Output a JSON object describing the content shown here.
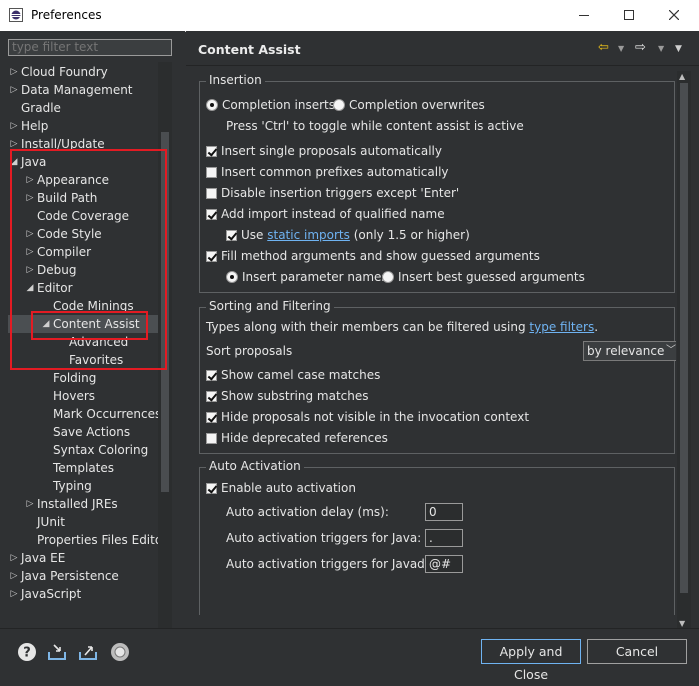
{
  "window": {
    "title": "Preferences"
  },
  "sidebar": {
    "filter_placeholder": "type filter text",
    "items": [
      {
        "label": "Cloud Foundry",
        "level": 0,
        "arrow": "right"
      },
      {
        "label": "Data Management",
        "level": 0,
        "arrow": "right"
      },
      {
        "label": "Gradle",
        "level": 0,
        "arrow": "none"
      },
      {
        "label": "Help",
        "level": 0,
        "arrow": "right"
      },
      {
        "label": "Install/Update",
        "level": 0,
        "arrow": "right"
      },
      {
        "label": "Java",
        "level": 0,
        "arrow": "down"
      },
      {
        "label": "Appearance",
        "level": 1,
        "arrow": "right"
      },
      {
        "label": "Build Path",
        "level": 1,
        "arrow": "right"
      },
      {
        "label": "Code Coverage",
        "level": 1,
        "arrow": "none"
      },
      {
        "label": "Code Style",
        "level": 1,
        "arrow": "right"
      },
      {
        "label": "Compiler",
        "level": 1,
        "arrow": "right"
      },
      {
        "label": "Debug",
        "level": 1,
        "arrow": "right"
      },
      {
        "label": "Editor",
        "level": 1,
        "arrow": "down"
      },
      {
        "label": "Code Minings",
        "level": 2,
        "arrow": "none"
      },
      {
        "label": "Content Assist",
        "level": 2,
        "arrow": "down"
      },
      {
        "label": "Advanced",
        "level": 3,
        "arrow": "none"
      },
      {
        "label": "Favorites",
        "level": 3,
        "arrow": "none"
      },
      {
        "label": "Folding",
        "level": 2,
        "arrow": "none"
      },
      {
        "label": "Hovers",
        "level": 2,
        "arrow": "none"
      },
      {
        "label": "Mark Occurrences",
        "level": 2,
        "arrow": "none"
      },
      {
        "label": "Save Actions",
        "level": 2,
        "arrow": "none"
      },
      {
        "label": "Syntax Coloring",
        "level": 2,
        "arrow": "none"
      },
      {
        "label": "Templates",
        "level": 2,
        "arrow": "none"
      },
      {
        "label": "Typing",
        "level": 2,
        "arrow": "none"
      },
      {
        "label": "Installed JREs",
        "level": 1,
        "arrow": "right"
      },
      {
        "label": "JUnit",
        "level": 1,
        "arrow": "none"
      },
      {
        "label": "Properties Files Edito",
        "level": 1,
        "arrow": "none"
      },
      {
        "label": "Java EE",
        "level": 0,
        "arrow": "right"
      },
      {
        "label": "Java Persistence",
        "level": 0,
        "arrow": "right"
      },
      {
        "label": "JavaScript",
        "level": 0,
        "arrow": "right"
      }
    ]
  },
  "main": {
    "title": "Content Assist",
    "insertion": {
      "title": "Insertion",
      "completion_inserts": "Completion inserts",
      "completion_overwrites": "Completion overwrites",
      "toggle_hint": "Press 'Ctrl' to toggle while content assist is active",
      "insert_single": "Insert single proposals automatically",
      "insert_common": "Insert common prefixes automatically",
      "disable_triggers": "Disable insertion triggers except 'Enter'",
      "add_import": "Add import instead of qualified name",
      "use_label": "Use",
      "static_imports": "static imports",
      "only_15": "(only 1.5 or higher)",
      "fill_method": "Fill method arguments and show guessed arguments",
      "insert_param_names": "Insert parameter names",
      "insert_best_guessed": "Insert best guessed arguments"
    },
    "sorting": {
      "title": "Sorting and Filtering",
      "types_text": "Types along with their members can be filtered using",
      "type_filters": "type filters",
      "period": ".",
      "sort_label": "Sort proposals",
      "sort_value": "by relevance",
      "camel_case": "Show camel case matches",
      "substring": "Show substring matches",
      "hide_invisible": "Hide proposals not visible in the invocation context",
      "hide_deprecated": "Hide deprecated references"
    },
    "auto_activation": {
      "title": "Auto Activation",
      "enable": "Enable auto activation",
      "delay_label": "Auto activation delay (ms):",
      "delay_value": "0",
      "java_label": "Auto activation triggers for Java:",
      "java_value": ".",
      "javadoc_label": "Auto activation triggers for Javadoc:",
      "javadoc_value": "@#"
    }
  },
  "footer": {
    "apply_close": "Apply and Close",
    "cancel": "Cancel"
  },
  "colors": {
    "background": "#2f3133",
    "highlight_box": "#e31b23",
    "link": "#6fb3f2",
    "nav_arrow": "#f0c419"
  }
}
